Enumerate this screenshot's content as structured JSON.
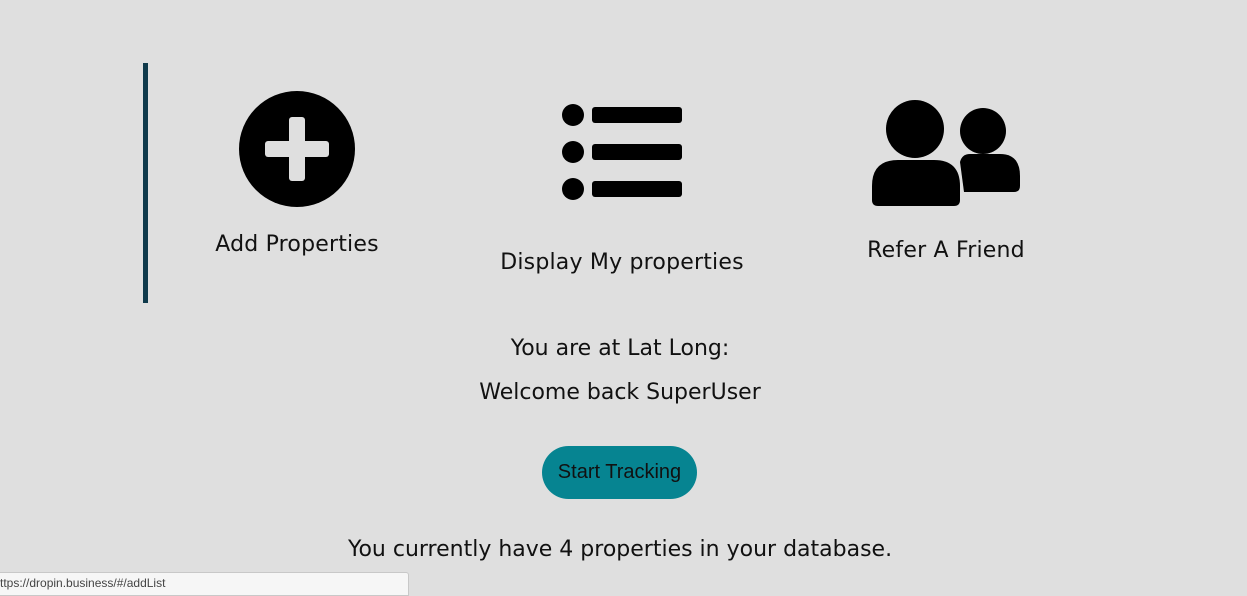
{
  "menu": {
    "items": [
      {
        "label": "Add Properties",
        "icon": "plus-circle-icon"
      },
      {
        "label": "Display My properties",
        "icon": "list-icon"
      },
      {
        "label": "Refer A Friend",
        "icon": "users-icon"
      }
    ]
  },
  "location": {
    "text": "You are at Lat Long:"
  },
  "welcome": {
    "text": "Welcome back SuperUser"
  },
  "tracking": {
    "button_label": "Start Tracking"
  },
  "properties": {
    "summary": "You currently have 4 properties in your database."
  },
  "status_bar": {
    "url": "ttps://dropin.business/#/addList"
  },
  "colors": {
    "background": "#dfdfdf",
    "accent_bar": "#0f3a4b",
    "button": "#068491"
  }
}
